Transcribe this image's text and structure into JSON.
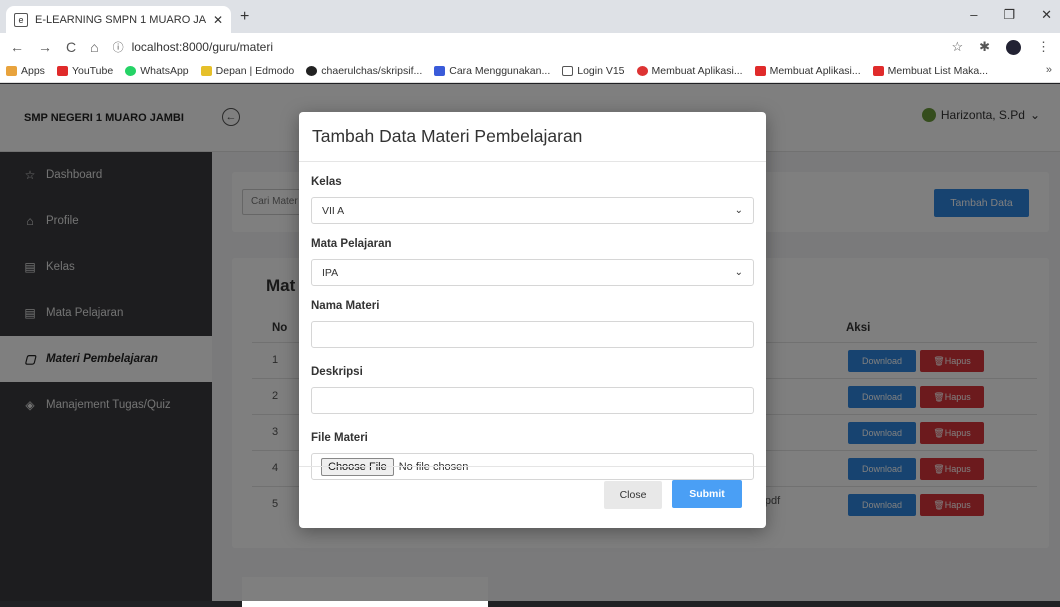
{
  "browser": {
    "tab_title": "E-LEARNING SMPN 1 MUARO JA",
    "new_tab": "+",
    "url": "localhost:8000/guru/materi",
    "bookmarks": [
      "Apps",
      "YouTube",
      "WhatsApp",
      "Depan | Edmodo",
      "chaerulchas/skripsif...",
      "Cara Menggunakan...",
      "Login V15",
      "Membuat Aplikasi...",
      "Membuat Aplikasi...",
      "Membuat List Maka..."
    ],
    "bookmark_more": "»"
  },
  "app": {
    "brand": "SMP NEGERI 1 MUARO JAMBI",
    "user": "Harizonta, S.Pd",
    "sidebar": [
      {
        "label": "Dashboard",
        "icon": "☆"
      },
      {
        "label": "Profile",
        "icon": "⌂"
      },
      {
        "label": "Kelas",
        "icon": "▤"
      },
      {
        "label": "Mata Pelajaran",
        "icon": "▤"
      },
      {
        "label": "Materi Pembelajaran",
        "icon": "▢"
      },
      {
        "label": "Manajement Tugas/Quiz",
        "icon": "◈"
      }
    ],
    "search_placeholder": "Cari Mater",
    "add_button": "Tambah Data",
    "table_title": "Mat",
    "col_no": "No",
    "col_aksi": "Aksi",
    "rows": [
      {
        "no": "1",
        "file": ""
      },
      {
        "no": "2",
        "file": ""
      },
      {
        "no": "3",
        "file": ""
      },
      {
        "no": "4",
        "file": ""
      },
      {
        "no": "5",
        "file": "2).pdf"
      }
    ],
    "download_label": "Download",
    "delete_label": "🗑Hapus"
  },
  "modal": {
    "title": "Tambah Data Materi Pembelajaran",
    "kelas_label": "Kelas",
    "kelas_value": "VII A",
    "mapel_label": "Mata Pelajaran",
    "mapel_value": "IPA",
    "nama_label": "Nama Materi",
    "nama_value": "",
    "deskripsi_label": "Deskripsi",
    "deskripsi_value": "",
    "file_label": "File Materi",
    "choose_file": "Choose File",
    "no_file": "No file chosen",
    "close": "Close",
    "submit": "Submit"
  }
}
